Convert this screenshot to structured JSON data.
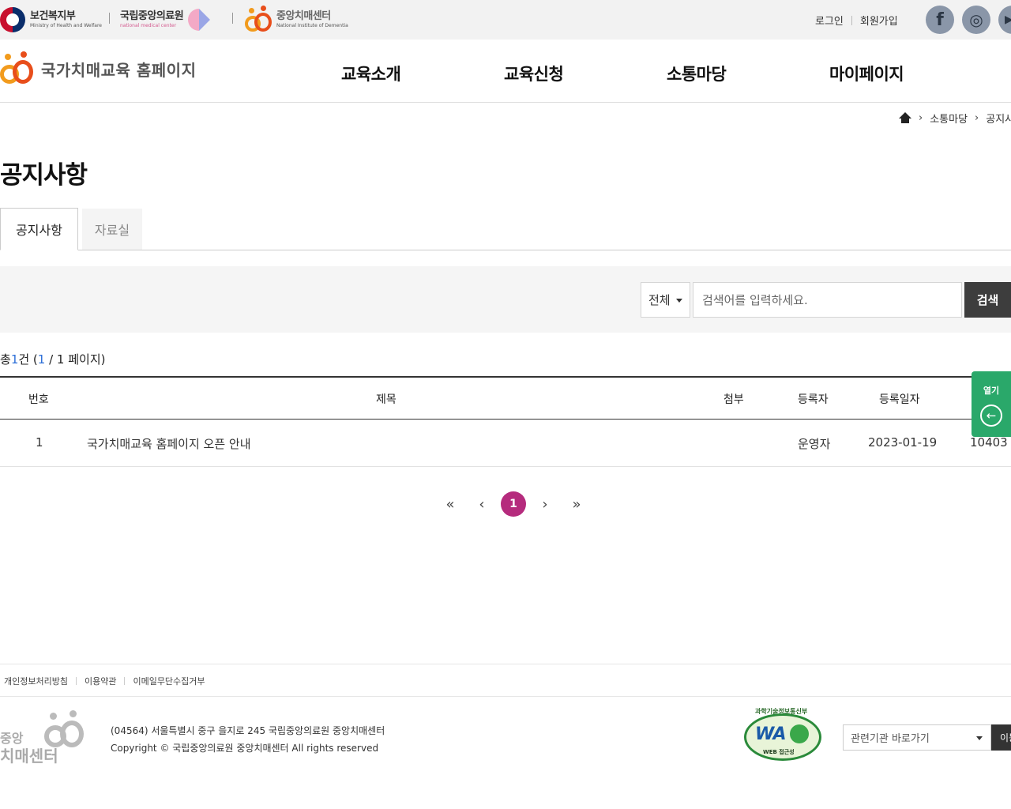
{
  "util_bar": {
    "mohw_name": "보건복지부",
    "mohw_sub": "Ministry of Health and Welfare",
    "nmc_name": "국립중앙의료원",
    "nmc_sub": "national medical center",
    "nid_name": "중앙치매센터",
    "nid_sub": "National Institute of Dementia",
    "login": "로그인",
    "join": "회원가입",
    "sns": [
      {
        "icon": "facebook-icon",
        "glyph": "f"
      },
      {
        "icon": "instagram-icon",
        "glyph": "◎"
      },
      {
        "icon": "youtube-icon",
        "glyph": "▶"
      }
    ]
  },
  "header": {
    "site_title": "국가치매교육 홈페이지",
    "menu": [
      "교육소개",
      "교육신청",
      "소통마당",
      "마이페이지"
    ]
  },
  "breadcrumb": {
    "items": [
      "소통마당",
      "공지사항"
    ]
  },
  "page_title": "공지사항",
  "tabs": [
    {
      "label": "공지사항",
      "active": true
    },
    {
      "label": "자료실",
      "active": false
    }
  ],
  "search": {
    "select_value": "전체",
    "placeholder": "검색어를 입력하세요.",
    "button": "검색"
  },
  "count": {
    "prefix": "총",
    "total": "1",
    "unit": "건 (",
    "current_page": "1",
    "separator": " / 1 페이지)"
  },
  "table": {
    "headers": [
      "번호",
      "제목",
      "첨부",
      "등록자",
      "등록일자"
    ],
    "rows": [
      {
        "no": "1",
        "title": "국가치매교육 홈페이지 오픈 안내",
        "attach": "",
        "author": "운영자",
        "date": "2023-01-19",
        "views": "10403"
      }
    ]
  },
  "side_panel": {
    "label": "열기",
    "icon": "arrow-left-icon"
  },
  "pagination": {
    "first": "«",
    "prev": "‹",
    "current": "1",
    "next": "›",
    "last": "»"
  },
  "footer": {
    "links": [
      "개인정보처리방침",
      "이용약관",
      "이메일무단수집거부"
    ],
    "logo_line1": "중앙",
    "logo_line2": "치매센터",
    "address": "(04564) 서울특별시 중구 을지로 245 국립중앙의료원 중앙치매센터",
    "copyright": "Copyright © 국립중앙의료원 중앙치매센터 All rights reserved",
    "wa_text": "WA",
    "wa_top": "과학기술정보통신부",
    "wa_sub": "WEB 접근성",
    "related_select": "관련기관 바로가기",
    "related_button": "이동"
  },
  "colors": {
    "accent_pagination": "#b52b7d",
    "side_panel": "#2aa86a",
    "count_highlight": "#2d6fd8",
    "search_button": "#3d3d3d"
  }
}
